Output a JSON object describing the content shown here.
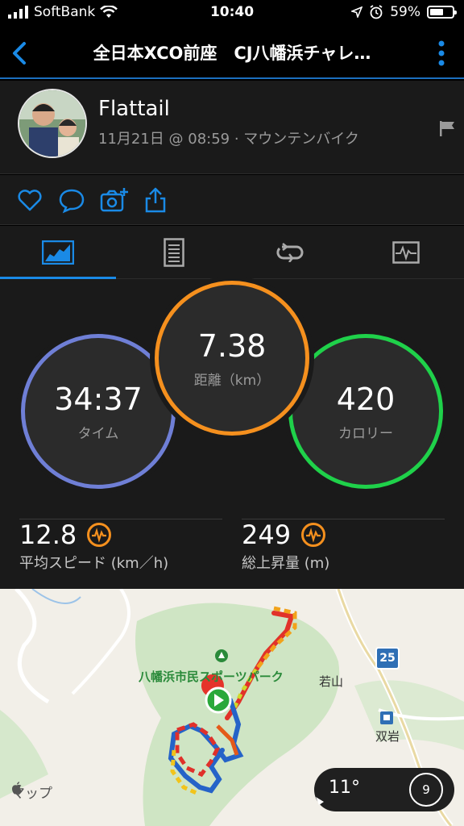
{
  "status_bar": {
    "carrier": "SoftBank",
    "time": "10:40",
    "battery": "59%"
  },
  "nav": {
    "title": "全日本XCO前座　CJ八幡浜チャレ…"
  },
  "activity": {
    "user_name": "Flattail",
    "meta": "11月21日 @ 08:59 · マウンテンバイク"
  },
  "icons": {
    "back": "chevron-left-icon",
    "more": "more-vertical-icon",
    "flag": "flag-icon",
    "like": "heart-icon",
    "comment": "comment-icon",
    "photo": "add-photo-icon",
    "share": "share-icon",
    "tab_overview": "overview-chart-icon",
    "tab_stats": "stats-list-icon",
    "tab_laps": "laps-loop-icon",
    "tab_charts": "heartrate-chart-icon"
  },
  "colors": {
    "accent": "#1a8ae6",
    "time_ring": "#6f7fd6",
    "distance_ring": "#f5901e",
    "calorie_ring": "#1fd14a"
  },
  "stats": {
    "time": {
      "value": "34:37",
      "label": "タイム"
    },
    "distance": {
      "value": "7.38",
      "label": "距離（km）"
    },
    "calories": {
      "value": "420",
      "label": "カロリー"
    }
  },
  "metrics": {
    "avg_speed": {
      "value": "12.8",
      "label": "平均スピード (km／h)"
    },
    "ascent": {
      "value": "249",
      "label": "総上昇量 (m)"
    }
  },
  "map": {
    "park_label": "八幡浜市民スポーツパーク",
    "place_wakayama": "若山",
    "place_sogan": "双岩",
    "route_number": "25",
    "attribution": "マップ",
    "temperature": "11°",
    "wind_speed": "9"
  }
}
